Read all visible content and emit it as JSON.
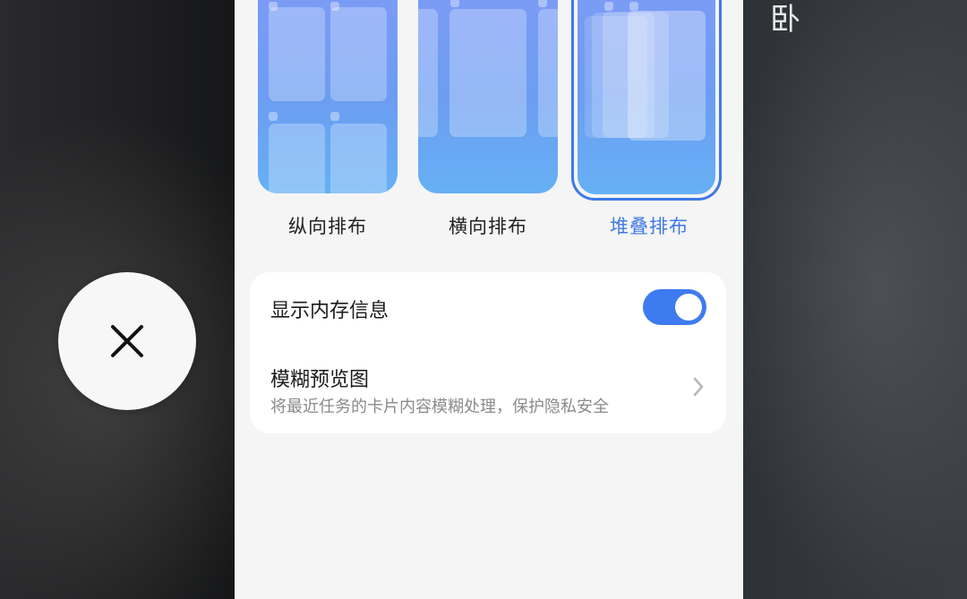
{
  "background": {
    "corner_glyph": "卧"
  },
  "close_button": {
    "icon": "close-icon"
  },
  "layouts": {
    "options": [
      {
        "label": "纵向排布",
        "selected": false
      },
      {
        "label": "横向排布",
        "selected": false
      },
      {
        "label": "堆叠排布",
        "selected": true
      }
    ],
    "selected_color": "#3f79e6"
  },
  "settings": {
    "show_memory": {
      "label": "显示内存信息",
      "enabled": true
    },
    "blur_preview": {
      "label": "模糊预览图",
      "description": "将最近任务的卡片内容模糊处理，保护隐私安全",
      "icon": "chevron-right-icon"
    }
  },
  "colors": {
    "accent": "#3e7bf0",
    "panel": "#f5f5f5",
    "card": "#ffffff"
  }
}
